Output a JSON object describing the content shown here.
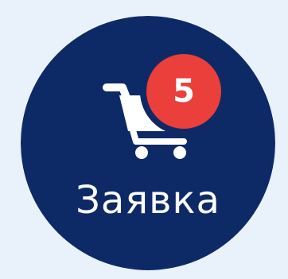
{
  "order_button": {
    "label": "Заявка",
    "badge_count": "5",
    "icon": "shopping-cart-icon"
  },
  "colors": {
    "page_background": "#e9f2fb",
    "circle": "#0e2a66",
    "badge_fill": "#ea3f3a",
    "badge_ring": "#0e2a66",
    "icon": "#ffffff",
    "text": "#ffffff"
  }
}
